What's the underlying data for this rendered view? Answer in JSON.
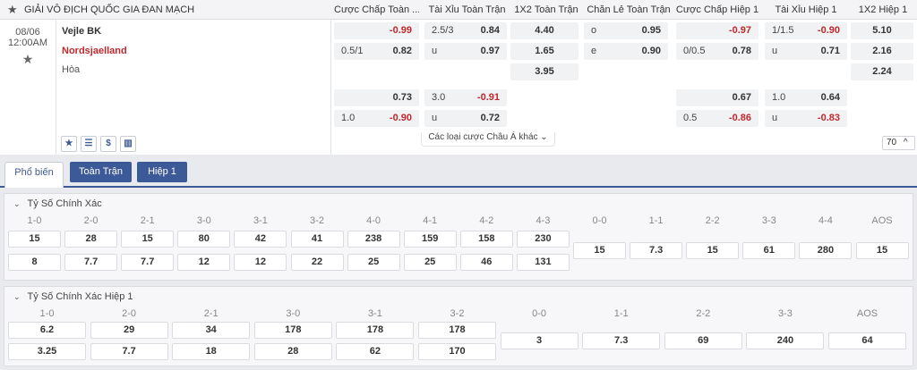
{
  "header": {
    "league": "GIẢI VÔ ĐỊCH QUỐC GIA ĐAN MẠCH",
    "columns": [
      "Cược Chấp Toàn ...",
      "Tài Xỉu Toàn Trận",
      "1X2 Toàn Trận",
      "Chẵn Lẻ Toàn Trận",
      "Cược Chấp Hiệp 1",
      "Tài Xỉu Hiệp 1",
      "1X2 Hiệp 1"
    ]
  },
  "match": {
    "date": "08/06",
    "time": "12:00AM",
    "home": "Vejle BK",
    "away": "Nordsjaelland",
    "draw": "Hòa",
    "more_label": "Các loại cược Châu Á khác",
    "count": "70",
    "main": {
      "hdp_ft": [
        [
          "",
          "-0.99"
        ],
        [
          "0.5/1",
          "0.82"
        ]
      ],
      "ou_ft": [
        [
          "2.5/3",
          "0.84"
        ],
        [
          "u",
          "0.97"
        ]
      ],
      "x12_ft": [
        "4.40",
        "1.65",
        "3.95"
      ],
      "oe_ft": [
        [
          "o",
          "0.95"
        ],
        [
          "e",
          "0.90"
        ]
      ],
      "hdp_h1": [
        [
          "",
          "-0.97"
        ],
        [
          "0/0.5",
          "0.78"
        ]
      ],
      "ou_h1": [
        [
          "1/1.5",
          "-0.90"
        ],
        [
          "u",
          "0.71"
        ]
      ],
      "x12_h1": [
        "5.10",
        "2.16",
        "2.24"
      ]
    },
    "alt": {
      "hdp_ft": [
        [
          "",
          "0.73"
        ],
        [
          "1.0",
          "-0.90"
        ]
      ],
      "ou_ft": [
        [
          "3.0",
          "-0.91"
        ],
        [
          "u",
          "0.72"
        ]
      ],
      "hdp_h1": [
        [
          "",
          "0.67"
        ],
        [
          "0.5",
          "-0.86"
        ]
      ],
      "ou_h1": [
        [
          "1.0",
          "0.64"
        ],
        [
          "u",
          "-0.83"
        ]
      ]
    }
  },
  "tabs": [
    "Phổ biến",
    "Toàn Trận",
    "Hiệp 1"
  ],
  "correct_score": {
    "title": "Tỷ Số Chính Xác",
    "labels": [
      "1-0",
      "2-0",
      "2-1",
      "3-0",
      "3-1",
      "3-2",
      "4-0",
      "4-1",
      "4-2",
      "4-3",
      "0-0",
      "1-1",
      "2-2",
      "3-3",
      "4-4",
      "AOS"
    ],
    "row1": [
      "15",
      "28",
      "15",
      "80",
      "42",
      "41",
      "238",
      "159",
      "158",
      "230"
    ],
    "row2": [
      "8",
      "7.7",
      "7.7",
      "12",
      "12",
      "22",
      "25",
      "25",
      "46",
      "131"
    ],
    "single": [
      "15",
      "7.3",
      "15",
      "61",
      "280",
      "15"
    ]
  },
  "correct_score_h1": {
    "title": "Tỷ Số Chính Xác Hiệp 1",
    "labels": [
      "1-0",
      "2-0",
      "2-1",
      "3-0",
      "3-1",
      "3-2",
      "0-0",
      "1-1",
      "2-2",
      "3-3",
      "AOS"
    ],
    "row1": [
      "6.2",
      "29",
      "34",
      "178",
      "178",
      "178"
    ],
    "row2": [
      "3.25",
      "7.7",
      "18",
      "28",
      "62",
      "170"
    ],
    "single": [
      "3",
      "7.3",
      "69",
      "240",
      "64"
    ]
  },
  "colors": {
    "accent": "#3d5a98",
    "negative": "#c0282d"
  },
  "icons": [
    "star-icon",
    "list-icon",
    "dollar-icon",
    "stats-icon",
    "chevron-down-icon",
    "chevron-up-icon"
  ]
}
